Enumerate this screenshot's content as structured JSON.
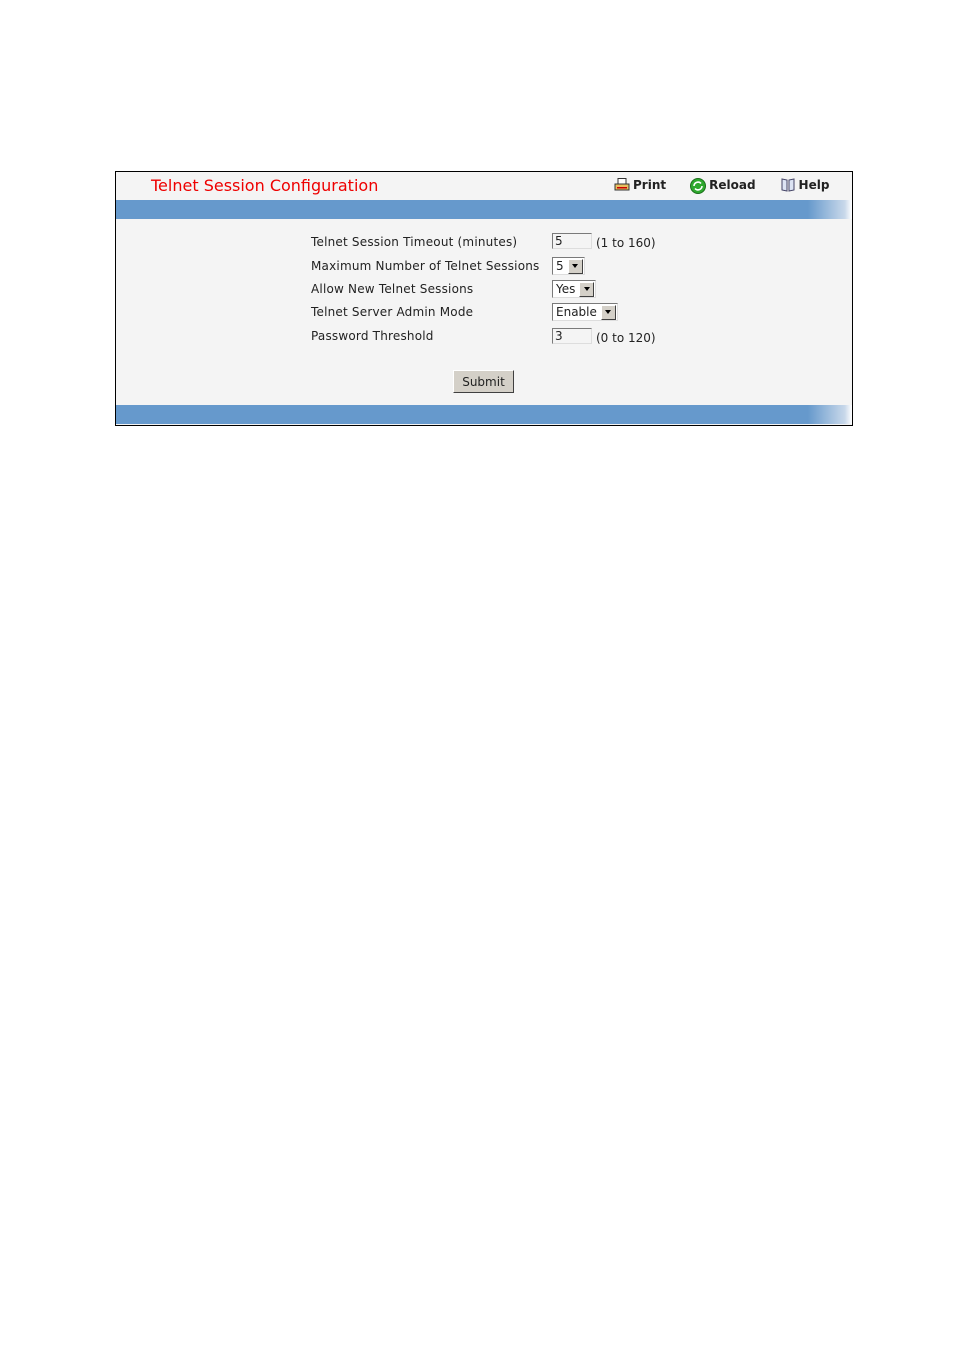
{
  "header": {
    "title": "Telnet Session Configuration",
    "tools": [
      {
        "label": "Print",
        "icon": "print-icon"
      },
      {
        "label": "Reload",
        "icon": "reload-icon"
      },
      {
        "label": "Help",
        "icon": "help-book-icon"
      }
    ]
  },
  "form": {
    "timeout": {
      "label": "Telnet Session Timeout (minutes)",
      "value": "5",
      "range": "(1 to 160)"
    },
    "max_sessions": {
      "label": "Maximum Number of Telnet Sessions",
      "value": "5"
    },
    "allow_new": {
      "label": "Allow New Telnet Sessions",
      "value": "Yes"
    },
    "admin_mode": {
      "label": "Telnet Server Admin Mode",
      "value": "Enable"
    },
    "password_threshold": {
      "label": "Password Threshold",
      "value": "3",
      "range": "(0 to 120)"
    },
    "submit_label": "Submit"
  },
  "colors": {
    "title": "#ee0000",
    "bar": "#6699cc",
    "panel_bg": "#f4f4f4"
  }
}
